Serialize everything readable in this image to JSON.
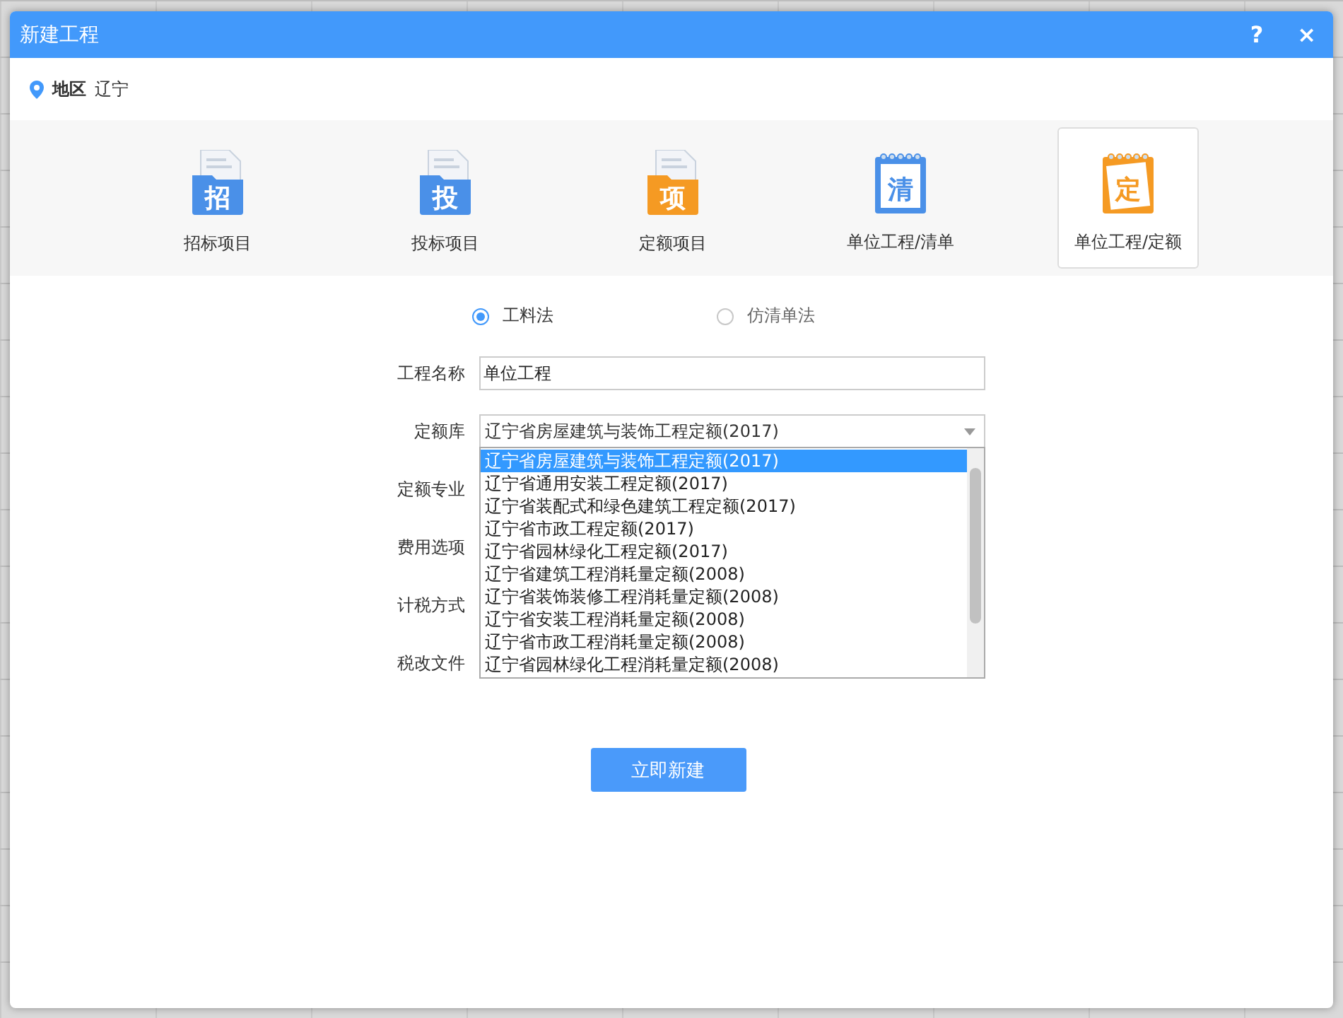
{
  "window": {
    "title": "新建工程",
    "help": "?",
    "close": "×"
  },
  "region": {
    "label": "地区",
    "value": "辽宁"
  },
  "project_types": [
    {
      "label": "招标项目",
      "glyph": "招",
      "kind": "folder",
      "color": "#4a90e8",
      "selected": false
    },
    {
      "label": "投标项目",
      "glyph": "投",
      "kind": "folder",
      "color": "#4a90e8",
      "selected": false
    },
    {
      "label": "定额项目",
      "glyph": "项",
      "kind": "folder",
      "color": "#f59a23",
      "selected": false
    },
    {
      "label": "单位工程/清单",
      "glyph": "清",
      "kind": "notebook",
      "color": "#4a90e8",
      "selected": false
    },
    {
      "label": "单位工程/定额",
      "glyph": "定",
      "kind": "notebook",
      "color": "#f59a23",
      "selected": true
    }
  ],
  "methods": [
    {
      "label": "工料法",
      "selected": true
    },
    {
      "label": "仿清单法",
      "selected": false
    }
  ],
  "fields": [
    {
      "label": "工程名称",
      "kind": "text",
      "value": "单位工程"
    },
    {
      "label": "定额库",
      "kind": "select",
      "value": "辽宁省房屋建筑与装饰工程定额(2017)",
      "expanded": true,
      "options": [
        {
          "label": "辽宁省房屋建筑与装饰工程定额(2017)",
          "selected": true
        },
        {
          "label": "辽宁省通用安装工程定额(2017)",
          "selected": false
        },
        {
          "label": "辽宁省装配式和绿色建筑工程定额(2017)",
          "selected": false
        },
        {
          "label": "辽宁省市政工程定额(2017)",
          "selected": false
        },
        {
          "label": "辽宁省园林绿化工程定额(2017)",
          "selected": false
        },
        {
          "label": "辽宁省建筑工程消耗量定额(2008)",
          "selected": false
        },
        {
          "label": "辽宁省装饰装修工程消耗量定额(2008)",
          "selected": false
        },
        {
          "label": "辽宁省安装工程消耗量定额(2008)",
          "selected": false
        },
        {
          "label": "辽宁省市政工程消耗量定额(2008)",
          "selected": false
        },
        {
          "label": "辽宁省园林绿化工程消耗量定额(2008)",
          "selected": false
        }
      ]
    },
    {
      "label": "定额专业",
      "kind": "covered"
    },
    {
      "label": "费用选项",
      "kind": "covered"
    },
    {
      "label": "计税方式",
      "kind": "covered"
    },
    {
      "label": "税改文件",
      "kind": "covered"
    }
  ],
  "submit": "立即新建"
}
